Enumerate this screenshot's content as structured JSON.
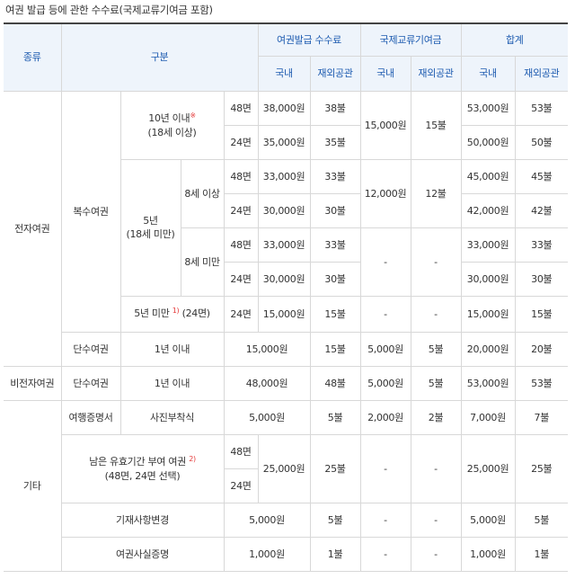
{
  "caption": "여권 발급 등에 관한 수수료(국제교류기여금 포함)",
  "header": {
    "type": "종류",
    "category": "구분",
    "issue_fee": "여권발급 수수료",
    "contribution": "국제교류기여금",
    "total": "합계",
    "domestic": "국내",
    "overseas": "재외공관"
  },
  "labels": {
    "electronic": "전자여권",
    "non_electronic": "비전자여권",
    "other": "기타",
    "multiple": "복수여권",
    "single": "단수여권",
    "within_10y": "10년 이내",
    "within_10y_mark": "※",
    "age18_plus": "(18세 이상)",
    "five_year": "5년",
    "under18": "(18세 미만)",
    "age8_plus": "8세 이상",
    "age8_under": "8세 미만",
    "under5": "5년 미만",
    "under5_mark": "1)",
    "under5_pages": "(24면)",
    "within_1y": "1년 이내",
    "travel_cert": "여행증명서",
    "photo_attach": "사진부착식",
    "remaining_validity": "남은 유효기간 부여 여권",
    "remaining_mark": "2)",
    "remaining_pages": "(48면, 24면 선택)",
    "record_change": "기재사항변경",
    "fact_cert": "여권사실증명",
    "p48": "48면",
    "p24": "24면",
    "dash": "-"
  },
  "values": {
    "w38000": "38,000원",
    "b38": "38불",
    "w35000": "35,000원",
    "b35": "35불",
    "w15000": "15,000원",
    "b15": "15불",
    "w33000": "33,000원",
    "b33": "33불",
    "w30000": "30,000원",
    "b30": "30불",
    "w12000": "12,000원",
    "b12": "12불",
    "w53000": "53,000원",
    "b53": "53불",
    "w50000": "50,000원",
    "b50": "50불",
    "w45000": "45,000원",
    "b45": "45불",
    "w42000": "42,000원",
    "b42": "42불",
    "w5000": "5,000원",
    "b5": "5불",
    "w20000": "20,000원",
    "b20": "20불",
    "w48000": "48,000원",
    "b48": "48불",
    "w2000": "2,000원",
    "b2": "2불",
    "w7000": "7,000원",
    "b7": "7불",
    "w25000": "25,000원",
    "b25": "25불",
    "w1000": "1,000원",
    "b1": "1불"
  }
}
